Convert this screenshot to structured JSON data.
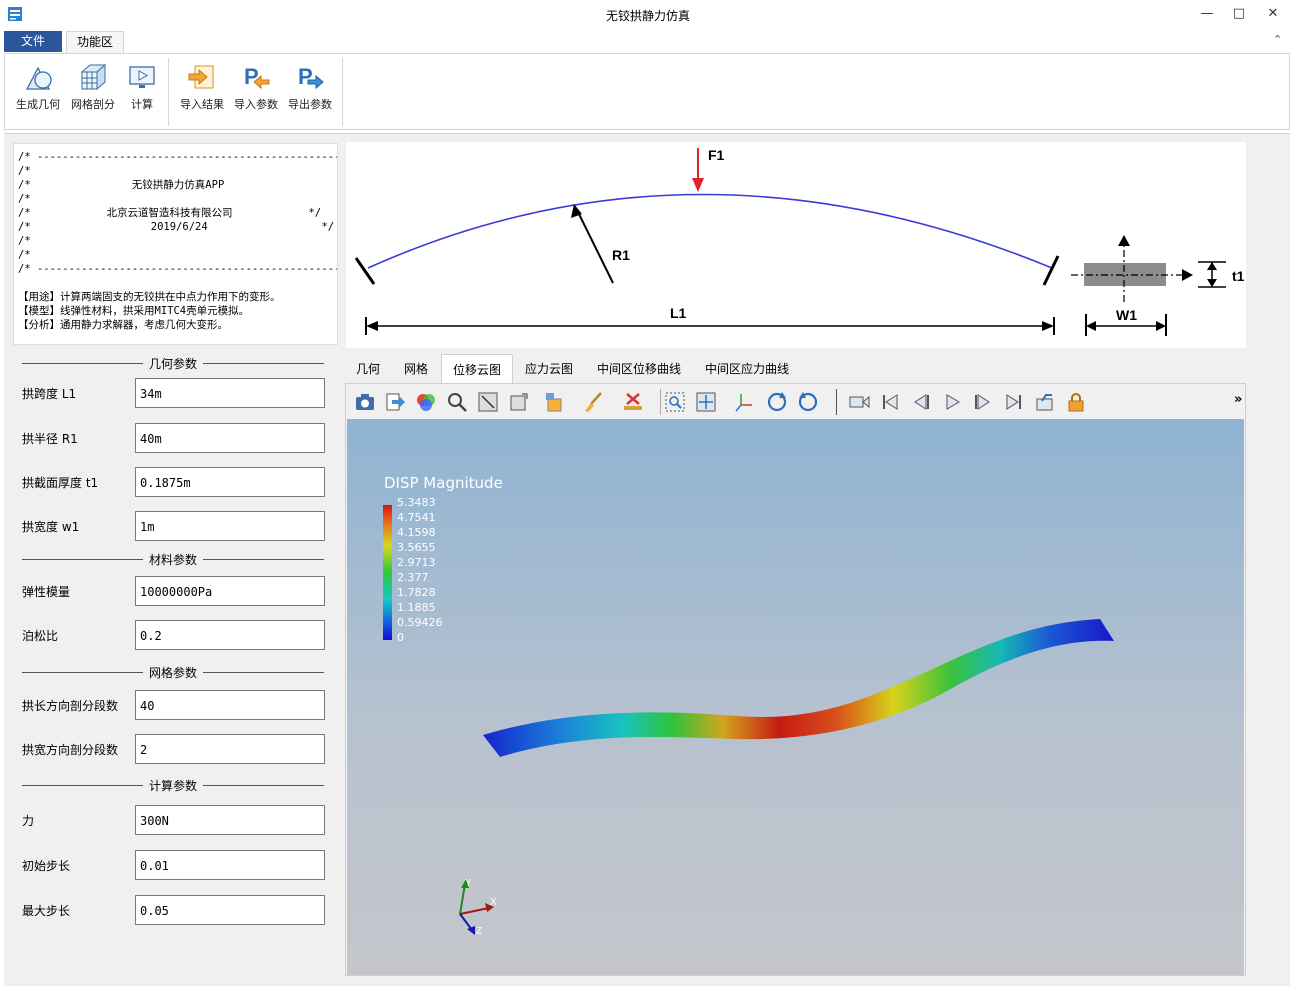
{
  "window": {
    "title": "无铰拱静力仿真"
  },
  "ribbon": {
    "tabs": {
      "file": "文件",
      "function": "功能区"
    },
    "buttons": {
      "gen_geometry": "生成几何",
      "mesh": "网格剖分",
      "compute": "计算",
      "import_result": "导入结果",
      "import_params": "导入参数",
      "export_params": "导出参数"
    }
  },
  "info": {
    "border_line": "/* ----------------------------------------------------- */",
    "app_name": "无铰拱静力仿真APP",
    "company": "北京云道智造科技有限公司",
    "date": "2019/6/24",
    "purpose": "【用途】计算两端固支的无铰拱在中点力作用下的变形。",
    "model": "【模型】线弹性材料，拱采用MITC4壳单元模拟。",
    "analysis": "【分析】通用静力求解器，考虑几何大变形。"
  },
  "params": {
    "geometry_title": "几何参数",
    "span_label": "拱跨度 L1",
    "span_value": "34m",
    "radius_label": "拱半径 R1",
    "radius_value": "40m",
    "thickness_label": "拱截面厚度 t1",
    "thickness_value": "0.1875m",
    "width_label": "拱宽度 w1",
    "width_value": "1m",
    "material_title": "材料参数",
    "modulus_label": "弹性模量",
    "modulus_value": "10000000Pa",
    "poisson_label": "泊松比",
    "poisson_value": "0.2",
    "mesh_title": "网格参数",
    "len_div_label": "拱长方向剖分段数",
    "len_div_value": "40",
    "wid_div_label": "拱宽方向剖分段数",
    "wid_div_value": "2",
    "calc_title": "计算参数",
    "force_label": "力",
    "force_value": "300N",
    "init_step_label": "初始步长",
    "init_step_value": "0.01",
    "max_step_label": "最大步长",
    "max_step_value": "0.05"
  },
  "diagram": {
    "F1": "F1",
    "R1": "R1",
    "L1": "L1",
    "W1": "W1",
    "t1": "t1"
  },
  "view_tabs": [
    "几何",
    "网格",
    "位移云图",
    "应力云图",
    "中间区位移曲线",
    "中间区应力曲线"
  ],
  "active_view_tab": "位移云图",
  "viewport": {
    "legend_title": "DISP Magnitude",
    "legend_ticks": [
      "5.3483",
      "4.7541",
      "4.1598",
      "3.5655",
      "2.9713",
      "2.377",
      "1.7828",
      "1.1885",
      "0.59426",
      "0"
    ],
    "axis_x": "X",
    "axis_y": "Y",
    "axis_z": "Z",
    "overflow_glyph": "»"
  },
  "colors": {
    "accent": "#2b579a",
    "arch_line": "#3b3bd6",
    "force_arrow": "#e0242a"
  }
}
